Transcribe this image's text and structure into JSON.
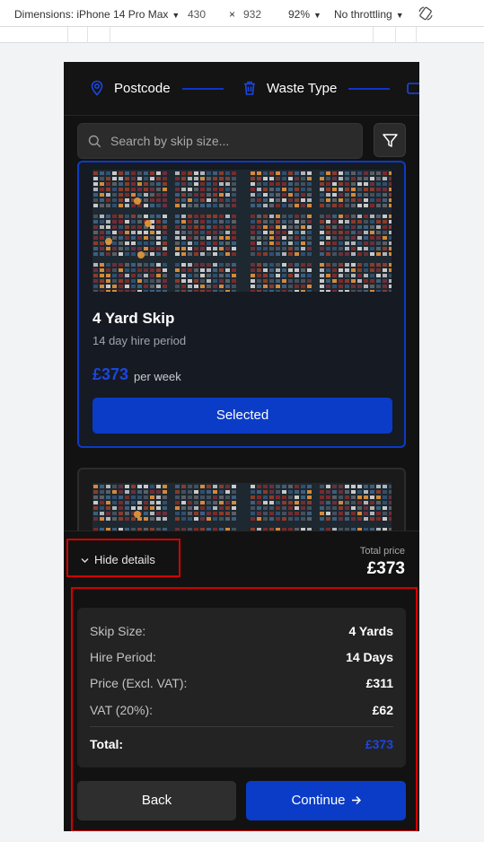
{
  "devtools": {
    "dimensions_label": "Dimensions: iPhone 14 Pro Max",
    "width": "430",
    "times": "×",
    "height": "932",
    "zoom": "92%",
    "throttling": "No throttling"
  },
  "stepper": {
    "steps": [
      {
        "label": "Postcode",
        "icon": "map-pin-icon"
      },
      {
        "label": "Waste Type",
        "icon": "trash-icon"
      }
    ],
    "accent": "#0a3cc7"
  },
  "search": {
    "placeholder": "Search by skip size..."
  },
  "card": {
    "title": "4 Yard Skip",
    "subtitle": "14 day hire period",
    "price": "£373",
    "per": "per week",
    "button": "Selected"
  },
  "bottom": {
    "toggle_label": "Hide details",
    "total_label": "Total price",
    "total_value": "£373",
    "rows": [
      {
        "label": "Skip Size:",
        "value": "4 Yards"
      },
      {
        "label": "Hire Period:",
        "value": "14 Days"
      },
      {
        "label": "Price (Excl. VAT):",
        "value": "£311"
      },
      {
        "label": "VAT (20%):",
        "value": "£62"
      }
    ],
    "total_row": {
      "label": "Total:",
      "value": "£373"
    },
    "back_label": "Back",
    "continue_label": "Continue"
  }
}
